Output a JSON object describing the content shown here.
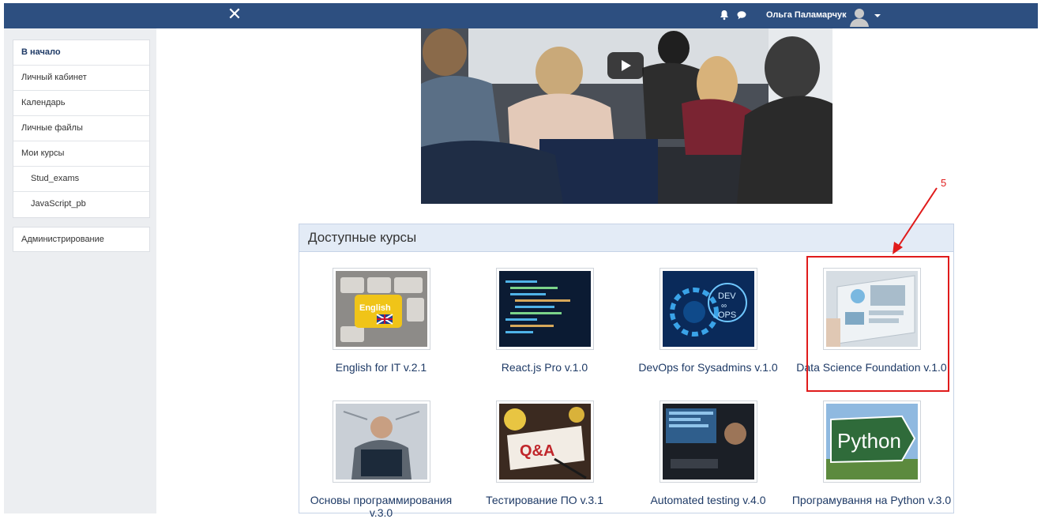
{
  "topbar": {
    "close_glyph": "✕",
    "user_name": "Ольга Паламарчук",
    "icons": [
      "bell-icon",
      "chat-icon",
      "user-avatar-icon",
      "caret-down-icon"
    ],
    "color": "#2d4f80"
  },
  "sidebar": {
    "items": [
      {
        "label": "В начало"
      },
      {
        "label": "Личный кабинет"
      },
      {
        "label": "Календарь"
      },
      {
        "label": "Личные файлы"
      },
      {
        "label": "Мои курсы"
      },
      {
        "label": "Stud_exams"
      },
      {
        "label": "JavaScript_pb"
      }
    ],
    "admin_label": "Администрирование"
  },
  "video": {
    "play_icon": "play-icon"
  },
  "courses": {
    "heading": "Доступные курсы",
    "items": [
      {
        "title": "English for IT v.2.1"
      },
      {
        "title": "React.js Pro v.1.0"
      },
      {
        "title": "DevOps for Sysadmins v.1.0"
      },
      {
        "title": "Data Science Foundation v.1.0"
      },
      {
        "title": "Основы программирования v.3.0"
      },
      {
        "title": "Тестирование ПО v.3.1"
      },
      {
        "title": "Automated testing v.4.0"
      },
      {
        "title": "Програмування на Python v.3.0"
      }
    ]
  },
  "annotation": {
    "number": "5",
    "color": "#e01b1b"
  }
}
